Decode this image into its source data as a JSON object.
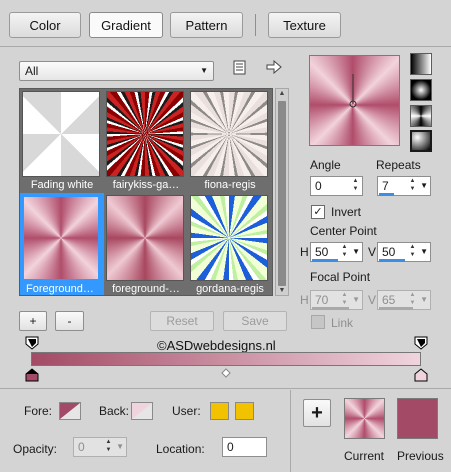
{
  "tabs": [
    {
      "label": "Color",
      "active": false
    },
    {
      "label": "Gradient",
      "active": true
    },
    {
      "label": "Pattern",
      "active": false
    },
    {
      "label": "Texture",
      "active": false
    }
  ],
  "category": {
    "selected": "All"
  },
  "gradients": [
    {
      "label": "Fading white",
      "selected": false
    },
    {
      "label": "fairykiss-ga…",
      "selected": false
    },
    {
      "label": "fiona-regis",
      "selected": false
    },
    {
      "label": "Foreground…",
      "selected": true
    },
    {
      "label": "foreground-…",
      "selected": false
    },
    {
      "label": "gordana-regis",
      "selected": false
    }
  ],
  "list_buttons": {
    "add": "+",
    "remove": "-",
    "reset": "Reset",
    "save": "Save"
  },
  "angle": {
    "label": "Angle",
    "value": "0"
  },
  "repeats": {
    "label": "Repeats",
    "value": "7"
  },
  "invert": {
    "label": "Invert",
    "checked": true
  },
  "center_point": {
    "label": "Center Point",
    "h_label": "H",
    "h_value": "50",
    "v_label": "V",
    "v_value": "50"
  },
  "focal_point": {
    "label": "Focal Point",
    "h_label": "H",
    "h_value": "70",
    "v_label": "V",
    "v_value": "65"
  },
  "link": {
    "label": "Link",
    "checked": false,
    "enabled": false
  },
  "watermark": "©ASDwebdesigns.nl",
  "gradient_stops": {
    "start_color": "#a34a66",
    "end_color": "#f0d4dd",
    "midpoint_percent": 50
  },
  "bottom": {
    "fore_label": "Fore:",
    "back_label": "Back:",
    "user_label": "User:",
    "opacity_label": "Opacity:",
    "opacity_value": "0",
    "location_label": "Location:",
    "location_value": "0",
    "add_button": "+",
    "current_label": "Current",
    "previous_label": "Previous"
  },
  "colors": {
    "foreground": "#a34a66",
    "background": "#f0d4dd",
    "user": "#f2c200",
    "previous": "#a34a66",
    "accent": "#3399ff"
  },
  "icons": [
    "list-view-icon",
    "arrow-right-icon",
    "gradient-linear-icon",
    "gradient-rect-icon",
    "gradient-sunburst-icon",
    "gradient-radial-icon"
  ]
}
